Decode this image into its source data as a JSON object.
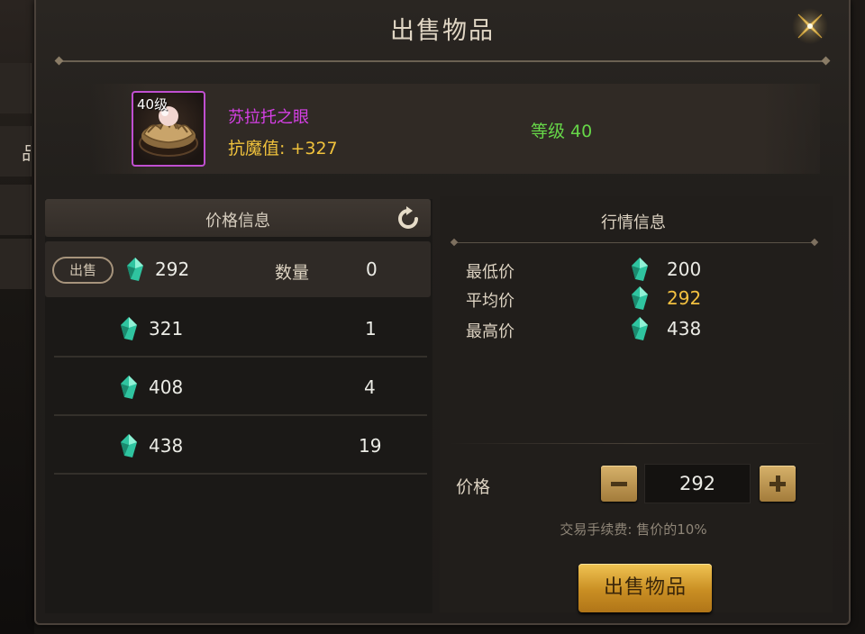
{
  "window": {
    "title": "出售物品"
  },
  "side_tabs": [
    {
      "label": ""
    },
    {
      "label": "品"
    },
    {
      "label": ""
    },
    {
      "label": ""
    }
  ],
  "item": {
    "level_tag": "40级",
    "name": "苏拉托之眼",
    "stat": "抗魔值: +327",
    "grade": "等级 40",
    "rarity_color": "#c04fd0"
  },
  "price_info": {
    "header": "价格信息",
    "sell_tag": "出售",
    "quantity_label": "数量",
    "rows": [
      {
        "price": "292",
        "quantity": "0"
      },
      {
        "price": "321",
        "quantity": "1"
      },
      {
        "price": "408",
        "quantity": "4"
      },
      {
        "price": "438",
        "quantity": "19"
      }
    ]
  },
  "market_info": {
    "header": "行情信息",
    "lowest": {
      "label": "最低价",
      "value": "200"
    },
    "average": {
      "label": "平均价",
      "value": "292"
    },
    "highest": {
      "label": "最高价",
      "value": "438"
    }
  },
  "price_input": {
    "label": "价格",
    "value": "292"
  },
  "fee_note": "交易手续费: 售价的10%",
  "sell_button_label": "出售物品",
  "colors": {
    "gem": "#2fc4a0",
    "gold": "#f2c040",
    "purple": "#d640e6",
    "green": "#66d648",
    "button_gold": "#e3ad3e"
  }
}
